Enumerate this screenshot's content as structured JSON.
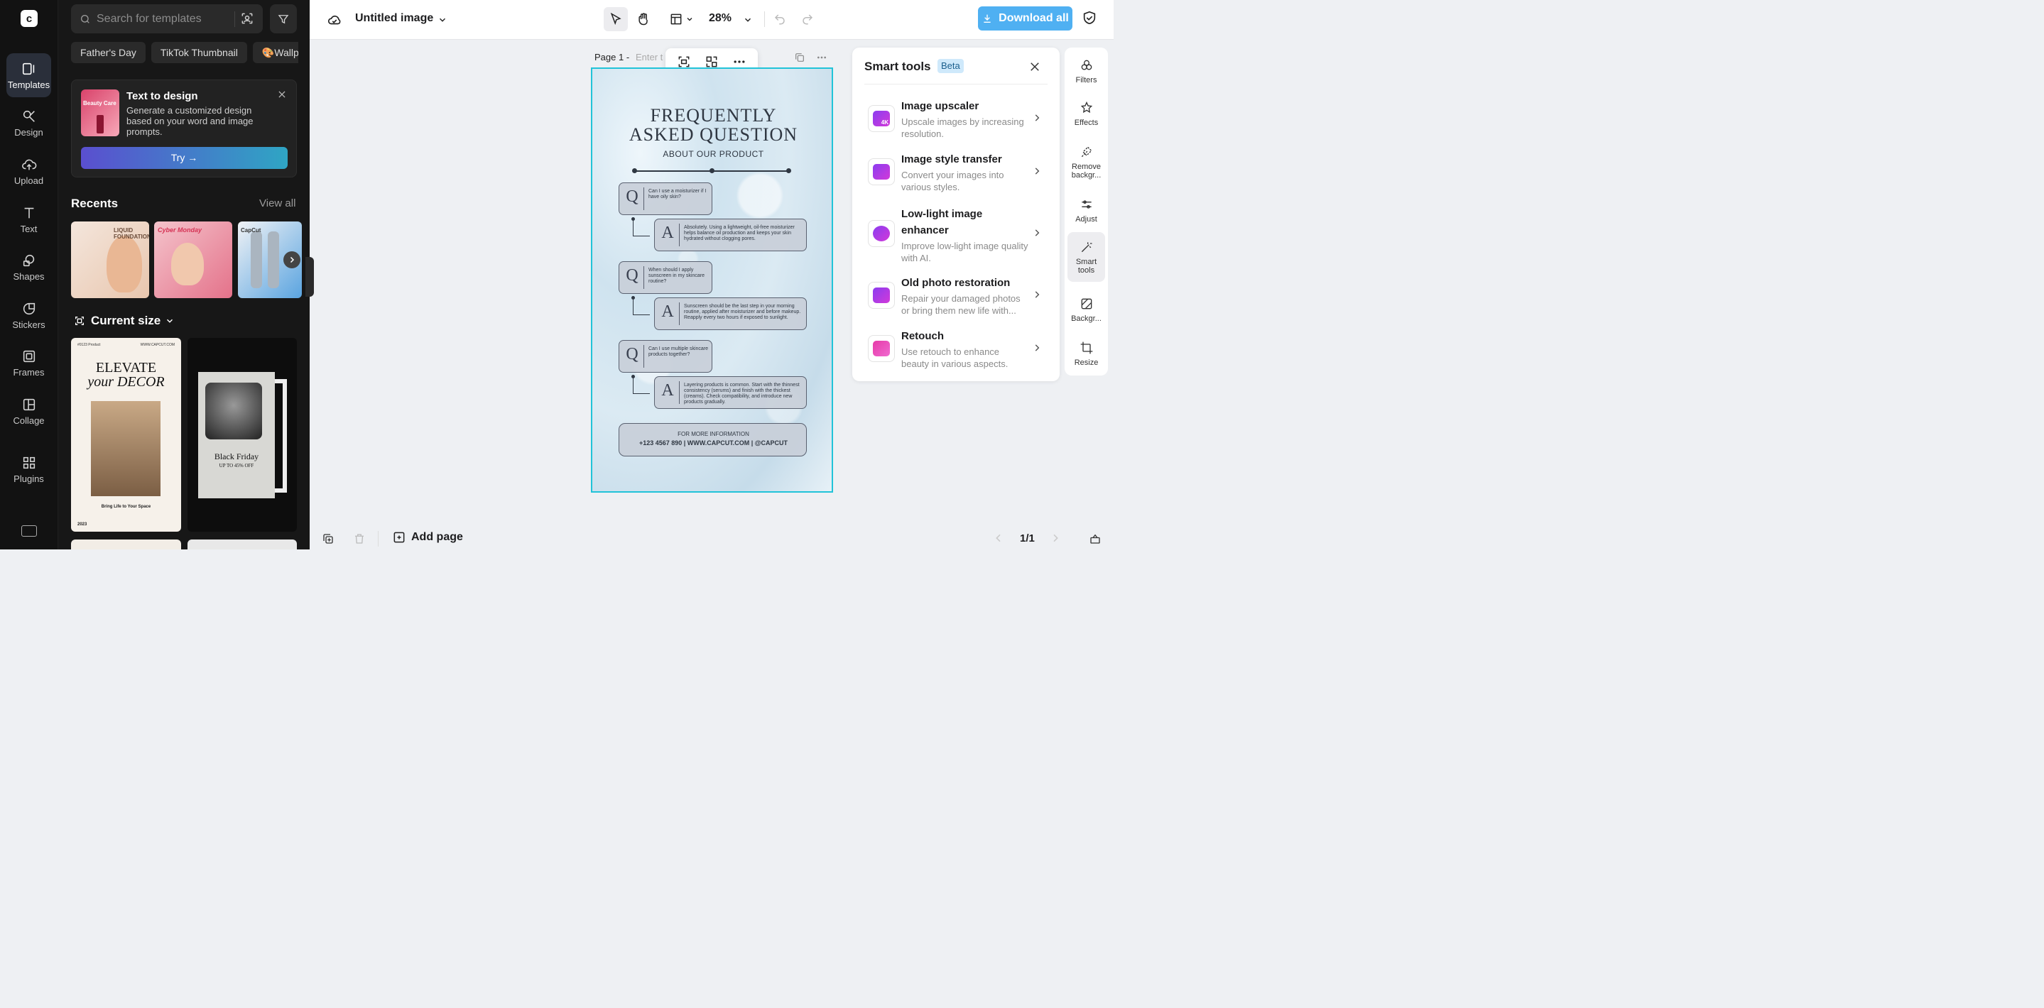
{
  "rail": {
    "items": [
      {
        "label": "Templates",
        "icon": "templates-icon"
      },
      {
        "label": "Design",
        "icon": "design-icon"
      },
      {
        "label": "Upload",
        "icon": "upload-icon"
      },
      {
        "label": "Text",
        "icon": "text-icon"
      },
      {
        "label": "Shapes",
        "icon": "shapes-icon"
      },
      {
        "label": "Stickers",
        "icon": "stickers-icon"
      },
      {
        "label": "Frames",
        "icon": "frames-icon"
      },
      {
        "label": "Collage",
        "icon": "collage-icon"
      },
      {
        "label": "Plugins",
        "icon": "plugins-icon"
      }
    ]
  },
  "panel": {
    "search_placeholder": "Search for templates",
    "chips": [
      "Father's Day",
      "TikTok Thumbnail",
      "🎨Wallp"
    ],
    "promo": {
      "thumb_label": "Beauty Care",
      "title": "Text to design",
      "desc": "Generate a customized design based on your word and image prompts.",
      "try_label": "Try →"
    },
    "recents_title": "Recents",
    "view_all": "View all",
    "recents": [
      {
        "label": "LIQUID FOUNDATION"
      },
      {
        "label": "Cyber Monday"
      },
      {
        "label": "CapCut"
      }
    ],
    "current_size": "Current size",
    "templates": [
      {
        "top_left": "#0123 Product",
        "top_right": "WWW.CAPCUT.COM",
        "line1": "ELEVATE",
        "line2": "your DECOR",
        "tagline": "Bring Life to Your Space",
        "year": "2023"
      },
      {
        "title": "Black Friday",
        "subtitle": "UP TO 45% OFF"
      }
    ]
  },
  "topbar": {
    "doc_title": "Untitled image",
    "zoom": "28%",
    "download_label": "Download all"
  },
  "canvas": {
    "page_label": "Page 1 -",
    "page_title_placeholder": "Enter t",
    "poster": {
      "title_line1": "FREQUENTLY",
      "title_line2": "ASKED QUESTION",
      "subtitle": "ABOUT OUR PRODUCT",
      "q_letter": "Q",
      "a_letter": "A",
      "qa": [
        {
          "q": "Can I use a moisturizer if I have oily skin?",
          "a": "Absolutely. Using a lightweight, oil-free moisturizer helps balance oil production and keeps your skin hydrated without clogging pores."
        },
        {
          "q": "When should I apply sunscreen in my skincare routine?",
          "a": "Sunscreen should be the last step in your morning routine, applied after moisturizer and before makeup. Reapply every two hours if exposed to sunlight."
        },
        {
          "q": "Can I use multiple skincare products together?",
          "a": "Layering products is common. Start with the thinnest consistency (serums) and finish with the thickest (creams). Check compatibility, and introduce new products gradually."
        }
      ],
      "info_title": "FOR MORE INFORMATION",
      "info_line": "+123 4567 890   |   WWW.CAPCUT.COM   |   @CAPCUT"
    }
  },
  "smart_tools": {
    "title": "Smart tools",
    "badge": "Beta",
    "items": [
      {
        "name": "Image upscaler",
        "desc": "Upscale images by increasing resolution.",
        "badge": "4K"
      },
      {
        "name": "Image style transfer",
        "desc": "Convert your images into various styles.",
        "badge": ""
      },
      {
        "name": "Low-light image enhancer",
        "desc": "Improve low-light image quality with AI.",
        "badge": ""
      },
      {
        "name": "Old photo restoration",
        "desc": "Repair your damaged photos or bring them new life with...",
        "badge": ""
      },
      {
        "name": "Retouch",
        "desc": "Use retouch to enhance beauty in various aspects.",
        "badge": ""
      }
    ]
  },
  "right_rail": {
    "items": [
      {
        "label": "Filters"
      },
      {
        "label": "Effects"
      },
      {
        "label": "Remove backgr..."
      },
      {
        "label": "Adjust"
      },
      {
        "label": "Smart tools"
      },
      {
        "label": "Backgr..."
      },
      {
        "label": "Resize"
      }
    ]
  },
  "bottombar": {
    "add_page": "Add page",
    "pager": "1/1"
  },
  "colors": {
    "accent": "#4fb0f2",
    "selection": "#21c3d8",
    "rail_bg": "#121212",
    "panel_bg": "#171717"
  }
}
